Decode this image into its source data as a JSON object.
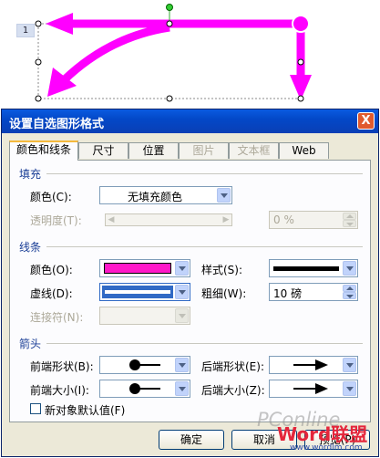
{
  "canvas": {
    "page_number": "1",
    "arrow_color": "#ff00ff"
  },
  "dialog": {
    "title": "设置自选图形格式",
    "close_label": "X",
    "tabs": [
      {
        "label": "颜色和线条",
        "active": true,
        "enabled": true
      },
      {
        "label": "尺寸",
        "active": false,
        "enabled": true
      },
      {
        "label": "位置",
        "active": false,
        "enabled": true
      },
      {
        "label": "图片",
        "active": false,
        "enabled": false
      },
      {
        "label": "文本框",
        "active": false,
        "enabled": false
      },
      {
        "label": "Web",
        "active": false,
        "enabled": true
      }
    ],
    "fill": {
      "section_title": "填充",
      "color_label": "颜色(C):",
      "color_value": "无填充颜色",
      "transparency_label": "透明度(T):",
      "transparency_value": "0 %"
    },
    "line": {
      "section_title": "线条",
      "color_label": "颜色(O):",
      "color_value": "#ff19c8",
      "style_label": "样式(S):",
      "dashed_label": "虚线(D):",
      "weight_label": "粗细(W):",
      "weight_value": "10 磅",
      "connector_label": "连接符(N):"
    },
    "arrows": {
      "section_title": "箭头",
      "begin_style_label": "前端形状(B):",
      "end_style_label": "后端形状(E):",
      "begin_size_label": "前端大小(I):",
      "end_size_label": "后端大小(Z):"
    },
    "default_checkbox_label": "新对象默认值(F)",
    "default_checked": false,
    "ok_label": "确定",
    "cancel_label": "取消",
    "preview_label": "预览(P)"
  },
  "watermark": {
    "pconline": "PConline",
    "site_tag": "Word联盟",
    "url": "www.wordlm.com"
  }
}
